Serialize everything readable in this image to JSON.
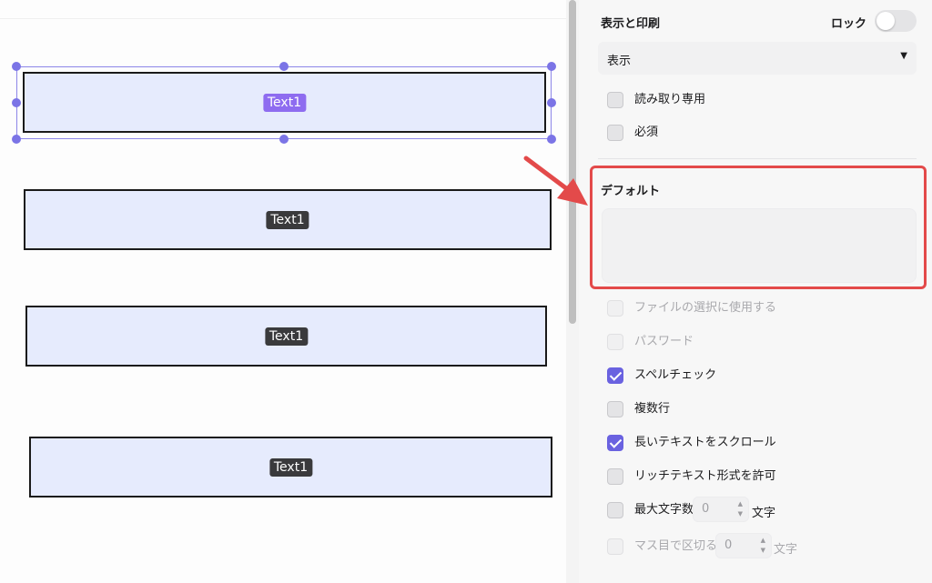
{
  "canvas": {
    "fields": [
      {
        "label": "Text1",
        "selected": true
      },
      {
        "label": "Text1",
        "selected": false
      },
      {
        "label": "Text1",
        "selected": false
      },
      {
        "label": "Text1",
        "selected": false
      }
    ]
  },
  "inspector": {
    "section_title": "表示と印刷",
    "lock_label": "ロック",
    "lock_on": false,
    "visibility_select": {
      "value": "表示"
    },
    "checkboxes_top": [
      {
        "label": "読み取り専用",
        "checked": false,
        "disabled": false
      },
      {
        "label": "必須",
        "checked": false,
        "disabled": false
      }
    ],
    "default": {
      "title": "デフォルト",
      "value": ""
    },
    "checkboxes_bottom": [
      {
        "label": "ファイルの選択に使用する",
        "checked": false,
        "disabled": true
      },
      {
        "label": "パスワード",
        "checked": false,
        "disabled": true
      },
      {
        "label": "スペルチェック",
        "checked": true,
        "disabled": false
      },
      {
        "label": "複数行",
        "checked": false,
        "disabled": false
      },
      {
        "label": "長いテキストをスクロール",
        "checked": true,
        "disabled": false
      },
      {
        "label": "リッチテキスト形式を許可",
        "checked": false,
        "disabled": false
      }
    ],
    "max_chars": {
      "label": "最大文字数",
      "value": "0",
      "unit": "文字",
      "checked": false,
      "disabled": false
    },
    "comb": {
      "label": "マス目で区切る",
      "value": "0",
      "unit": "文字",
      "checked": false,
      "disabled": true
    }
  },
  "colors": {
    "accent": "#6a62e0",
    "highlight": "#e34a4a",
    "field_fill": "#e6ebfd",
    "selected_tag": "#8e6cf0"
  }
}
